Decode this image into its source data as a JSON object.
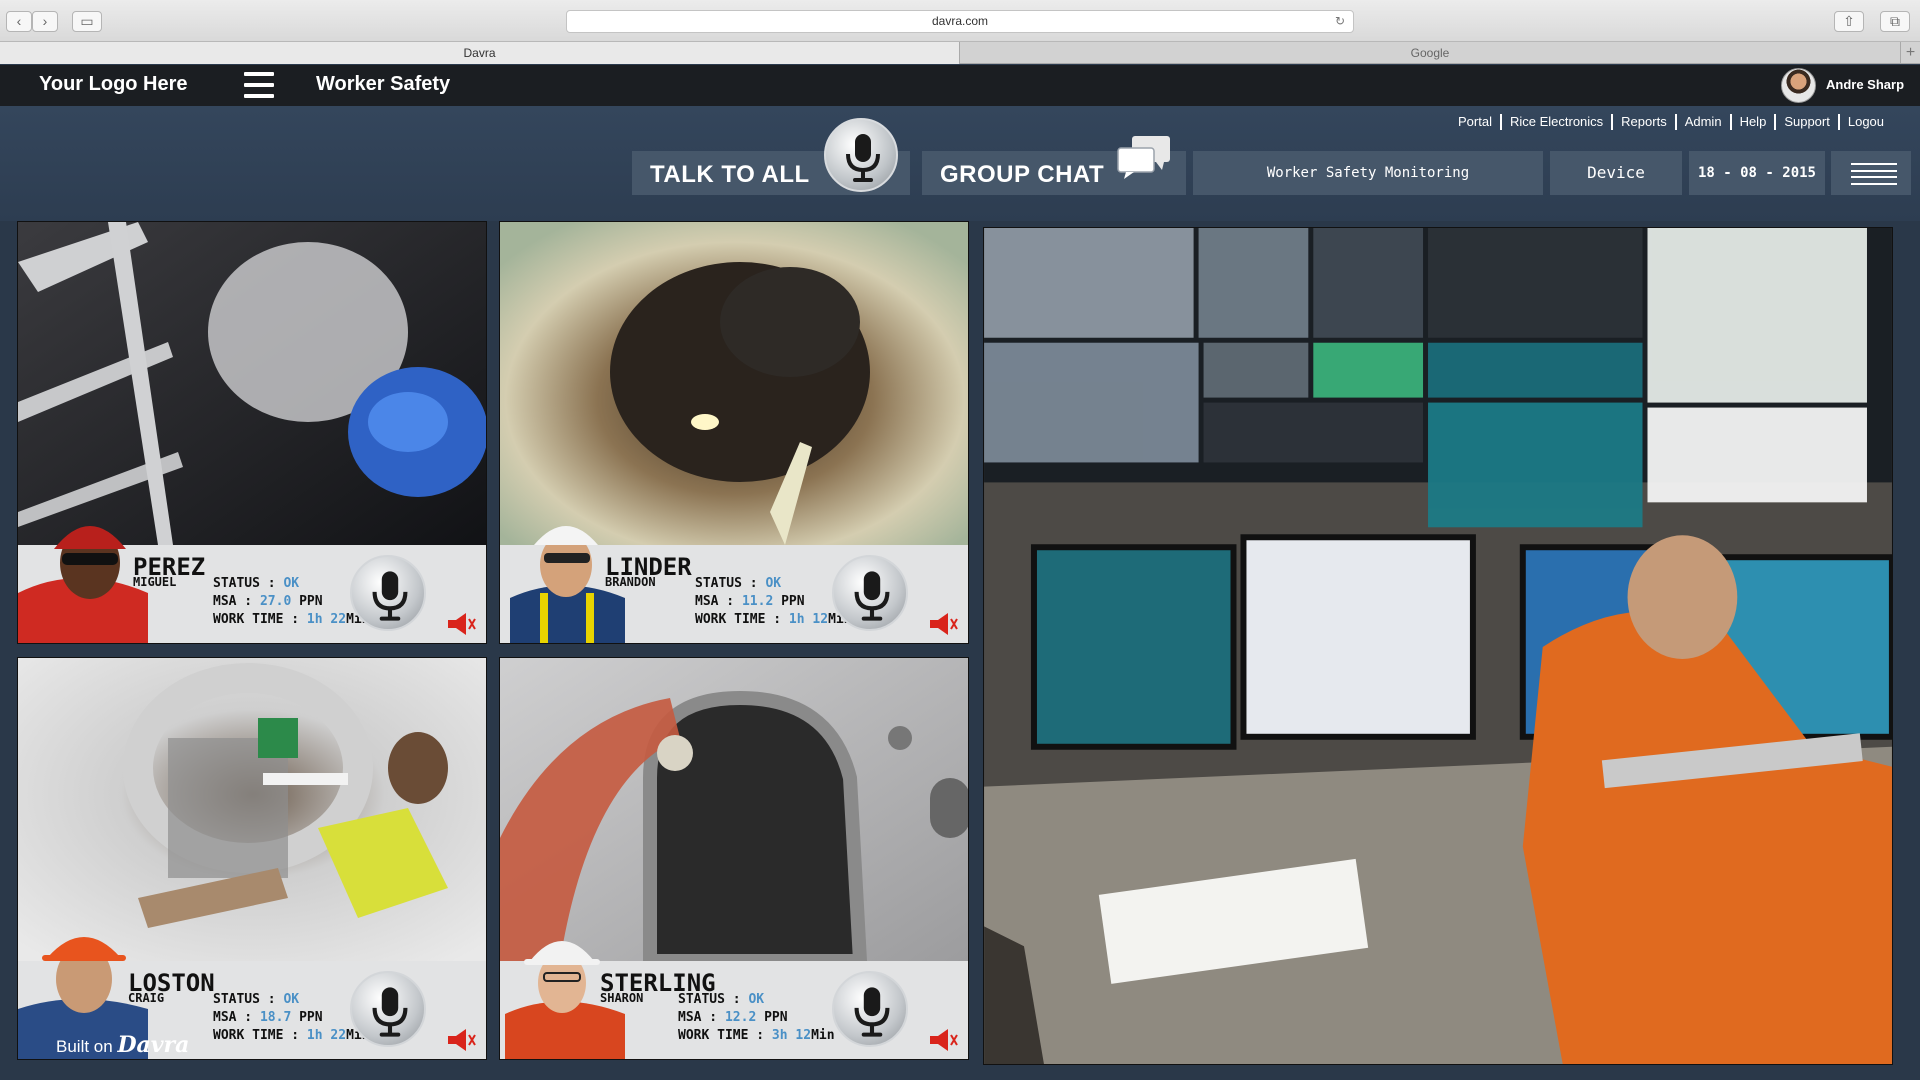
{
  "browser": {
    "url": "davra.com",
    "tabs": [
      {
        "label": "Davra",
        "active": true
      },
      {
        "label": "Google",
        "active": false
      }
    ]
  },
  "app": {
    "logo": "Your Logo Here",
    "title": "Worker Safety",
    "user": "Andre Sharp"
  },
  "nav": [
    "Portal",
    "Rice Electronics",
    "Reports",
    "Admin",
    "Help",
    "Support",
    "Logou"
  ],
  "controls": {
    "talk_to_all": "TALK TO ALL",
    "group_chat": "GROUP CHAT",
    "monitoring": "Worker Safety Monitoring",
    "device": "Device",
    "date": "18 - 08 - 2015"
  },
  "stat_labels": {
    "status": "STATUS : ",
    "msa": "MSA : ",
    "work_time": "WORK TIME : "
  },
  "workers": [
    {
      "last": "PEREZ",
      "first": "MIGUEL",
      "status": "OK",
      "msa": "27.0",
      "msa_unit": " PPN",
      "hours": "1h",
      "mins": "22",
      "min_unit": "Min"
    },
    {
      "last": "LINDER",
      "first": "BRANDON",
      "status": "OK",
      "msa": "11.2",
      "msa_unit": " PPN",
      "hours": "1h",
      "mins": "12",
      "min_unit": "Min"
    },
    {
      "last": "LOSTON",
      "first": "CRAIG",
      "status": "OK",
      "msa": "18.7",
      "msa_unit": " PPN",
      "hours": "1h",
      "mins": "22",
      "min_unit": "Min"
    },
    {
      "last": "STERLING",
      "first": "SHARON",
      "status": "OK",
      "msa": "12.2",
      "msa_unit": " PPN",
      "hours": "3h",
      "mins": "12",
      "min_unit": "Min"
    }
  ],
  "footer": {
    "built_on": "Built on",
    "brand": "Davra"
  },
  "colors": {
    "stat_value": "#4a90c6",
    "header_bg": "#1b1e22",
    "subbar_bg": "#34465c",
    "button_bg": "#46576a"
  }
}
